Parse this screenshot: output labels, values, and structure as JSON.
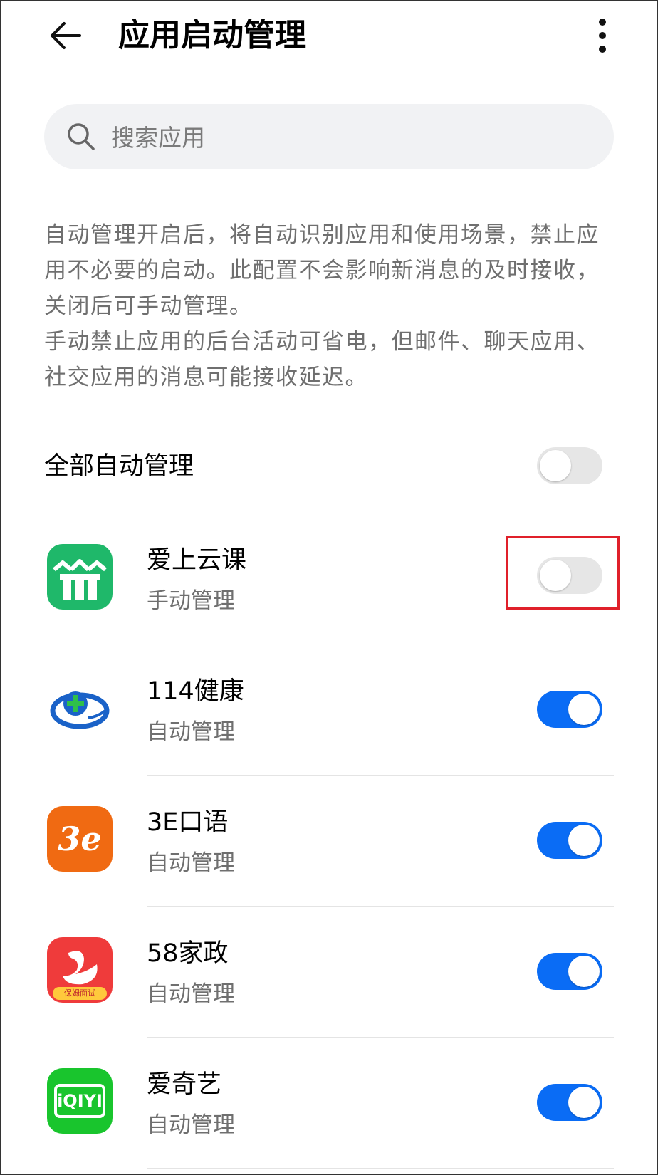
{
  "header": {
    "title": "应用启动管理",
    "back_icon": "arrow-left-icon",
    "more_icon": "more-vertical-icon"
  },
  "search": {
    "placeholder": "搜索应用",
    "icon": "search-icon"
  },
  "description": {
    "paragraph1": "自动管理开启后，将自动识别应用和使用场景，禁止应用不必要的启动。此配置不会影响新消息的及时接收，关闭后可手动管理。",
    "paragraph2": "手动禁止应用的后台活动可省电，但邮件、聊天应用、社交应用的消息可能接收延迟。"
  },
  "all_auto": {
    "label": "全部自动管理",
    "enabled": false
  },
  "apps": [
    {
      "name": "爱上云课",
      "status": "手动管理",
      "enabled": false,
      "icon": "aishangyunke-app-icon",
      "color": "#1fb86a"
    },
    {
      "name": "114健康",
      "status": "自动管理",
      "enabled": true,
      "icon": "health114-app-icon",
      "color": "#1a62c8"
    },
    {
      "name": "3E口语",
      "status": "自动管理",
      "enabled": true,
      "icon": "3e-kouyu-app-icon",
      "color": "#f06a12"
    },
    {
      "name": "58家政",
      "status": "自动管理",
      "enabled": true,
      "icon": "58-jiazheng-app-icon",
      "color": "#ef3b3b"
    },
    {
      "name": "爱奇艺",
      "status": "自动管理",
      "enabled": true,
      "icon": "iqiyi-app-icon",
      "color": "#19c52d"
    }
  ],
  "app_icon_text": {
    "jiazheng_badge": "保姆面试",
    "iqiyi_logo": "iQIYI",
    "e3_logo": "3e"
  },
  "colors": {
    "toggle_on": "#0a6cf5",
    "toggle_off": "#e6e6e6",
    "highlight_box": "#e0202a"
  }
}
